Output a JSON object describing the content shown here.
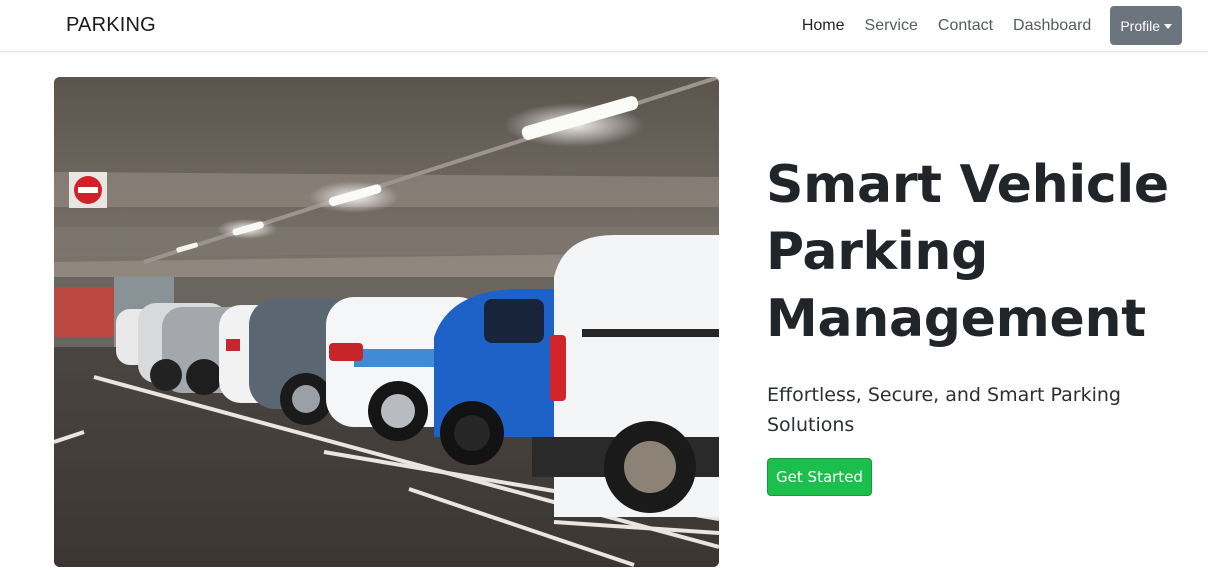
{
  "navbar": {
    "brand": "PARKING",
    "links": [
      {
        "label": "Home",
        "active": true
      },
      {
        "label": "Service"
      },
      {
        "label": "Contact"
      },
      {
        "label": "Dashboard"
      }
    ],
    "profile_label": "Profile"
  },
  "hero": {
    "title_line1": "Smart Vehicle",
    "title_line2": "Parking",
    "title_line3": "Management",
    "subtitle": "Effortless, Secure, and Smart Parking Solutions",
    "cta_label": "Get Started",
    "cta_color": "#1bbf4b"
  },
  "colors": {
    "profile_button": "#6c757d",
    "text": "#212529"
  }
}
